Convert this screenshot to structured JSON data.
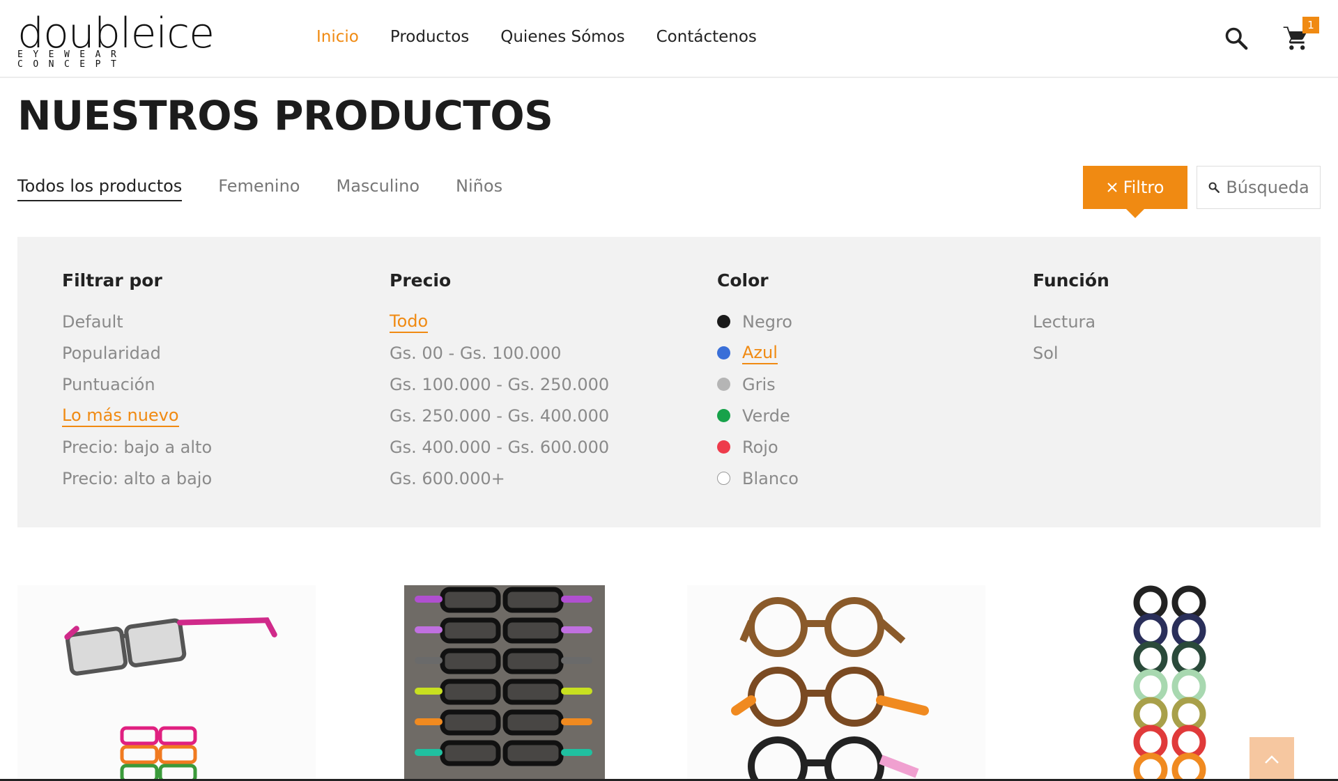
{
  "logo": {
    "main": "doubleice",
    "sub": "EYEWEAR CONCEPT"
  },
  "nav": [
    {
      "label": "Inicio",
      "active": true
    },
    {
      "label": "Productos",
      "active": false
    },
    {
      "label": "Quienes Sómos",
      "active": false
    },
    {
      "label": "Contáctenos",
      "active": false
    }
  ],
  "cart": {
    "count": "1",
    "icon": "cart-icon"
  },
  "search_icon": "search-icon",
  "page_title": "NUESTROS PRODUCTOS",
  "tabs": [
    "Todos los productos",
    "Femenino",
    "Masculino",
    "Niños"
  ],
  "filter_button": {
    "label": "Filtro",
    "icon": "close-icon"
  },
  "search_button": {
    "label": "Búsqueda",
    "icon": "search-icon"
  },
  "filters": {
    "sort": {
      "title": "Filtrar por",
      "options": [
        "Default",
        "Popularidad",
        "Puntuación",
        "Lo más nuevo",
        "Precio: bajo a alto",
        "Precio: alto a bajo"
      ],
      "selected": "Lo más nuevo"
    },
    "price": {
      "title": "Precio",
      "options": [
        "Todo",
        "Gs. 00 - Gs. 100.000",
        "Gs. 100.000 - Gs. 250.000",
        "Gs. 250.000 - Gs. 400.000",
        "Gs. 400.000 - Gs. 600.000",
        "Gs. 600.000+"
      ],
      "selected": "Todo"
    },
    "color": {
      "title": "Color",
      "options": [
        {
          "label": "Negro",
          "color": "#1a1a1a"
        },
        {
          "label": "Azul",
          "color": "#3a6fd8"
        },
        {
          "label": "Gris",
          "color": "#b5b5b5"
        },
        {
          "label": "Verde",
          "color": "#17a24a"
        },
        {
          "label": "Rojo",
          "color": "#ee3b4b"
        },
        {
          "label": "Blanco",
          "color": "#ffffff"
        }
      ],
      "selected": "Azul"
    },
    "function": {
      "title": "Función",
      "options": [
        "Lectura",
        "Sol"
      ]
    }
  },
  "colors": {
    "accent": "#f08a12",
    "panel": "#f2f2f2"
  },
  "back_to_top_icon": "chevron-up-icon"
}
